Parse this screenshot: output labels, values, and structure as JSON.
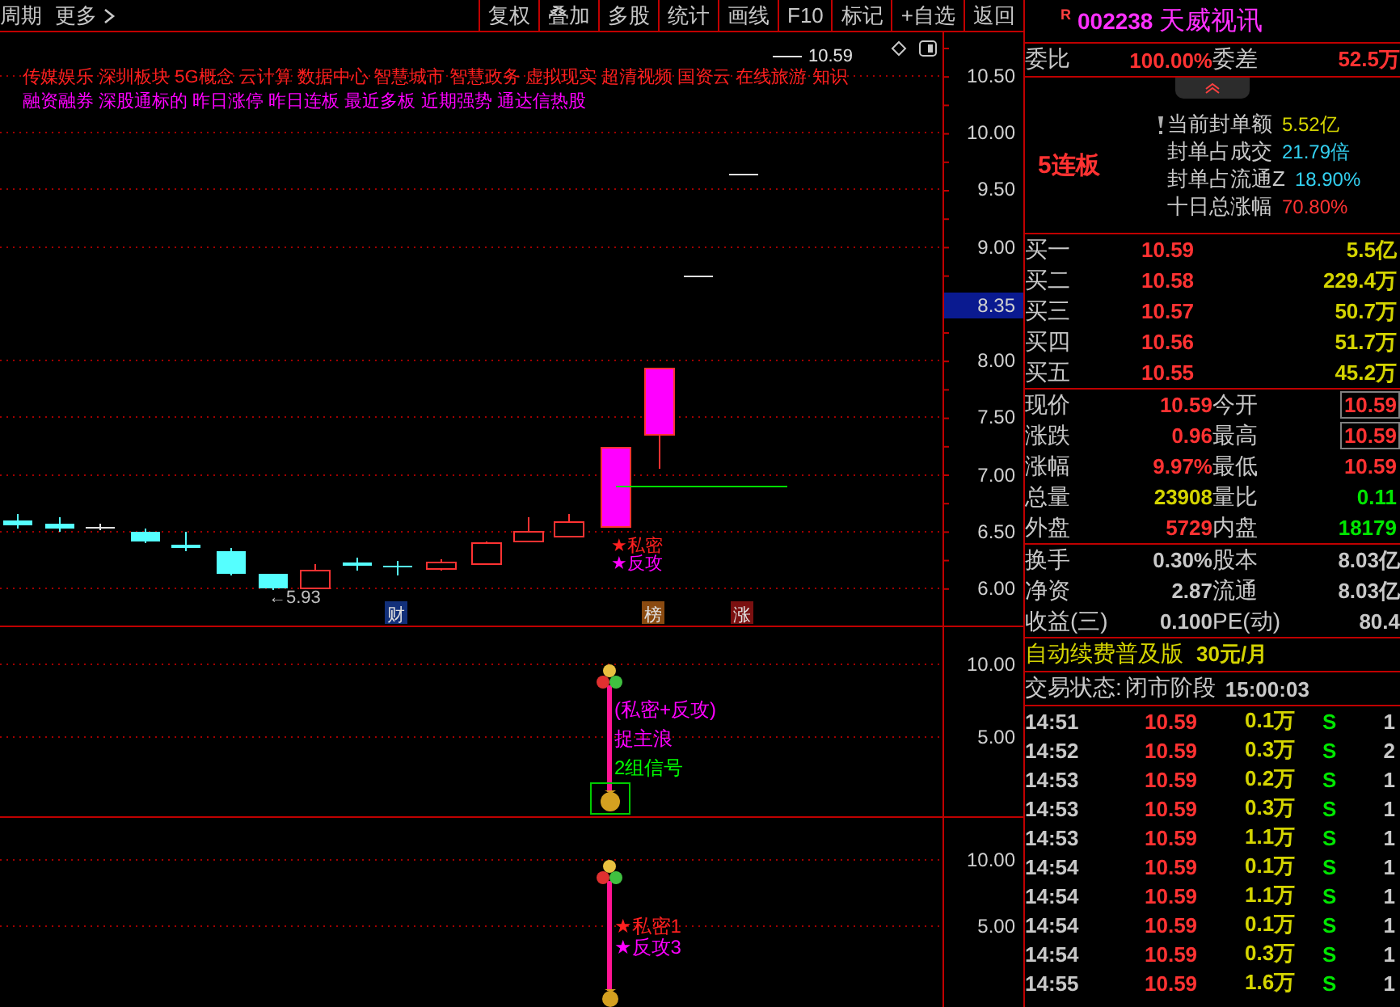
{
  "toolbar": {
    "period": "周期",
    "more": "更多",
    "buttons": [
      "复权",
      "叠加",
      "多股",
      "统计",
      "画线",
      "F10",
      "标记",
      "+自选",
      "返回"
    ]
  },
  "main_chart": {
    "concept_tags": "传媒娱乐 深圳板块 5G概念 云计算 数据中心 智慧城市 智慧政务 虚拟现实 超清视频 国资云 在线旅游 知识",
    "attribute_tags": "融资融券 深股通标的 昨日涨停 昨日连板 最近多板 近期强势 通达信热股",
    "price_axis": [
      "10.50",
      "10.00",
      "9.50",
      "9.00",
      "8.00",
      "7.50",
      "7.00",
      "6.50",
      "6.00"
    ],
    "current_price_marker": "8.35",
    "high_label": "10.59",
    "low_label": "←5.93",
    "signals": [
      {
        "text": "★私密",
        "color": "#ff2020"
      },
      {
        "text": "★反攻",
        "color": "#ff00ff"
      }
    ],
    "badges": [
      {
        "text": "财",
        "kind": "finance"
      },
      {
        "text": "榜",
        "kind": "ranking"
      },
      {
        "text": "涨",
        "kind": "limit"
      }
    ]
  },
  "indicator_1": {
    "axis": [
      "10.00",
      "5.00"
    ],
    "labels": [
      {
        "text": "(私密+反攻)",
        "color": "#ff00ff"
      },
      {
        "text": "捉主浪",
        "color": "#ff00ff"
      },
      {
        "text": "2组信号",
        "color": "#00ff00"
      }
    ]
  },
  "indicator_2": {
    "axis": [
      "10.00",
      "5.00"
    ],
    "labels": [
      {
        "text": "★私密1",
        "color": "#ff2020"
      },
      {
        "text": "★反攻3",
        "color": "#ff00ff"
      }
    ]
  },
  "header": {
    "market_mark": "R",
    "code": "002238",
    "name": "天威视讯"
  },
  "order_ratio": {
    "label": "委比",
    "value": "100.00%",
    "diff_label": "委差",
    "diff_value": "52.5万"
  },
  "streak": {
    "badge": "5连板",
    "items": [
      {
        "label": "当前封单额",
        "value": "5.52亿",
        "color": "#d4d400"
      },
      {
        "label": "封单占成交",
        "value": "21.79倍",
        "color": "#33d0f0"
      },
      {
        "label": "封单占流通Z",
        "value": "18.90%",
        "color": "#33d0f0"
      },
      {
        "label": "十日总涨幅",
        "value": "70.80%",
        "color": "#ff3232"
      }
    ]
  },
  "bids": [
    {
      "label": "买一",
      "price": "10.59",
      "volume": "5.5亿"
    },
    {
      "label": "买二",
      "price": "10.58",
      "volume": "229.4万"
    },
    {
      "label": "买三",
      "price": "10.57",
      "volume": "50.7万"
    },
    {
      "label": "买四",
      "price": "10.56",
      "volume": "51.7万"
    },
    {
      "label": "买五",
      "price": "10.55",
      "volume": "45.2万"
    }
  ],
  "quote": [
    {
      "left": {
        "label": "现价",
        "value": "10.59",
        "color": "#ff3232"
      },
      "right": {
        "label": "今开",
        "value": "10.59",
        "color": "#ff3232",
        "boxed": true
      }
    },
    {
      "left": {
        "label": "涨跌",
        "value": "0.96",
        "color": "#ff3232"
      },
      "right": {
        "label": "最高",
        "value": "10.59",
        "color": "#ff3232",
        "boxed": true
      }
    },
    {
      "left": {
        "label": "涨幅",
        "value": "9.97%",
        "color": "#ff3232"
      },
      "right": {
        "label": "最低",
        "value": "10.59",
        "color": "#ff3232",
        "boxed": false
      }
    },
    {
      "left": {
        "label": "总量",
        "value": "23908",
        "color": "#d4d400"
      },
      "right": {
        "label": "量比",
        "value": "0.11",
        "color": "#00e600",
        "boxed": false
      }
    },
    {
      "left": {
        "label": "外盘",
        "value": "5729",
        "color": "#ff3232"
      },
      "right": {
        "label": "内盘",
        "value": "18179",
        "color": "#00e600",
        "boxed": false
      }
    }
  ],
  "fundamentals": [
    {
      "label": "换手",
      "value": "0.30%",
      "label2": "股本",
      "value2": "8.03亿"
    },
    {
      "label": "净资",
      "value": "2.87",
      "label2": "流通",
      "value2": "8.03亿"
    },
    {
      "label": "收益(三)",
      "value": "0.100",
      "label2": "PE(动)",
      "value2": "80.4"
    }
  ],
  "ad": {
    "product": "自动续费普及版",
    "price": "30元/月"
  },
  "status": {
    "label": "交易状态:",
    "value": "闭市阶段",
    "time": "15:00:03"
  },
  "ticks": [
    {
      "time": "14:51",
      "price": "10.59",
      "volume": "0.1万",
      "side": "S",
      "count": "1"
    },
    {
      "time": "14:52",
      "price": "10.59",
      "volume": "0.3万",
      "side": "S",
      "count": "2"
    },
    {
      "time": "14:53",
      "price": "10.59",
      "volume": "0.2万",
      "side": "S",
      "count": "1"
    },
    {
      "time": "14:53",
      "price": "10.59",
      "volume": "0.3万",
      "side": "S",
      "count": "1"
    },
    {
      "time": "14:53",
      "price": "10.59",
      "volume": "1.1万",
      "side": "S",
      "count": "1"
    },
    {
      "time": "14:54",
      "price": "10.59",
      "volume": "0.1万",
      "side": "S",
      "count": "1"
    },
    {
      "time": "14:54",
      "price": "10.59",
      "volume": "1.1万",
      "side": "S",
      "count": "1"
    },
    {
      "time": "14:54",
      "price": "10.59",
      "volume": "0.1万",
      "side": "S",
      "count": "1"
    },
    {
      "time": "14:54",
      "price": "10.59",
      "volume": "0.3万",
      "side": "S",
      "count": "1"
    },
    {
      "time": "14:55",
      "price": "10.59",
      "volume": "1.6万",
      "side": "S",
      "count": "1"
    }
  ]
}
